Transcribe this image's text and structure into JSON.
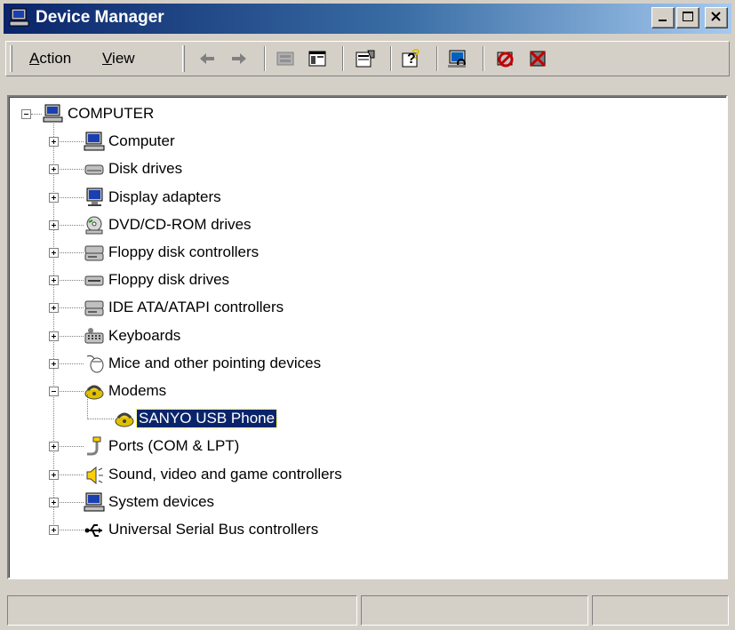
{
  "window": {
    "title": "Device Manager"
  },
  "menu": [
    {
      "label": "Action",
      "accel": "A",
      "rest": "ction"
    },
    {
      "label": "View",
      "accel": "V",
      "rest": "iew"
    }
  ],
  "toolbar_icons": [
    "back-arrow-icon",
    "forward-arrow-icon",
    "up-folder-icon",
    "show-hide-tree-icon",
    "properties-icon",
    "help-icon",
    "scan-hardware-icon",
    "uninstall-icon",
    "disable-icon"
  ],
  "tree": {
    "root": "COMPUTER",
    "items": [
      {
        "label": "Computer",
        "icon": "computer-icon",
        "expanded": false
      },
      {
        "label": "Disk drives",
        "icon": "disk-drive-icon",
        "expanded": false
      },
      {
        "label": "Display adapters",
        "icon": "display-adapter-icon",
        "expanded": false
      },
      {
        "label": "DVD/CD-ROM drives",
        "icon": "cdrom-icon",
        "expanded": false
      },
      {
        "label": "Floppy disk controllers",
        "icon": "controller-icon",
        "expanded": false
      },
      {
        "label": "Floppy disk drives",
        "icon": "floppy-drive-icon",
        "expanded": false
      },
      {
        "label": "IDE ATA/ATAPI controllers",
        "icon": "controller-icon",
        "expanded": false
      },
      {
        "label": "Keyboards",
        "icon": "keyboard-icon",
        "expanded": false
      },
      {
        "label": "Mice and other pointing devices",
        "icon": "mouse-icon",
        "expanded": false
      },
      {
        "label": "Modems",
        "icon": "modem-icon",
        "expanded": true
      },
      {
        "label": "SANYO USB Phone",
        "icon": "modem-icon",
        "child": true,
        "selected": true
      },
      {
        "label": "Ports (COM & LPT)",
        "icon": "port-icon",
        "expanded": false
      },
      {
        "label": "Sound, video and game controllers",
        "icon": "speaker-icon",
        "expanded": false
      },
      {
        "label": "System devices",
        "icon": "computer-icon",
        "expanded": false
      },
      {
        "label": "Universal Serial Bus controllers",
        "icon": "usb-icon",
        "expanded": false
      }
    ]
  },
  "statusbar": {
    "panels": [
      "",
      "",
      ""
    ]
  }
}
